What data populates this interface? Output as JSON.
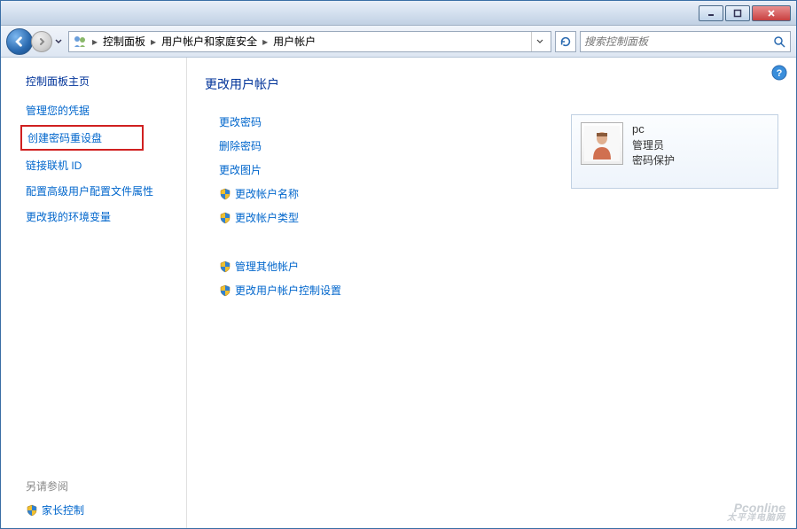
{
  "breadcrumb": {
    "items": [
      "控制面板",
      "用户帐户和家庭安全",
      "用户帐户"
    ]
  },
  "search": {
    "placeholder": "搜索控制面板"
  },
  "sidebar": {
    "home": "控制面板主页",
    "links": [
      "管理您的凭据",
      "创建密码重设盘",
      "链接联机 ID",
      "配置高级用户配置文件属性",
      "更改我的环境变量"
    ],
    "seealso_hdr": "另请参阅",
    "seealso": "家长控制"
  },
  "content": {
    "title": "更改用户帐户",
    "tasks_plain": [
      "更改密码",
      "删除密码",
      "更改图片"
    ],
    "tasks_shield": [
      "更改帐户名称",
      "更改帐户类型"
    ],
    "tasks_group2": [
      "管理其他帐户",
      "更改用户帐户控制设置"
    ],
    "user": {
      "name": "pc",
      "role": "管理员",
      "pw": "密码保护"
    }
  },
  "watermark": {
    "line1": "Pconline",
    "line2": "太平洋电脑网"
  }
}
